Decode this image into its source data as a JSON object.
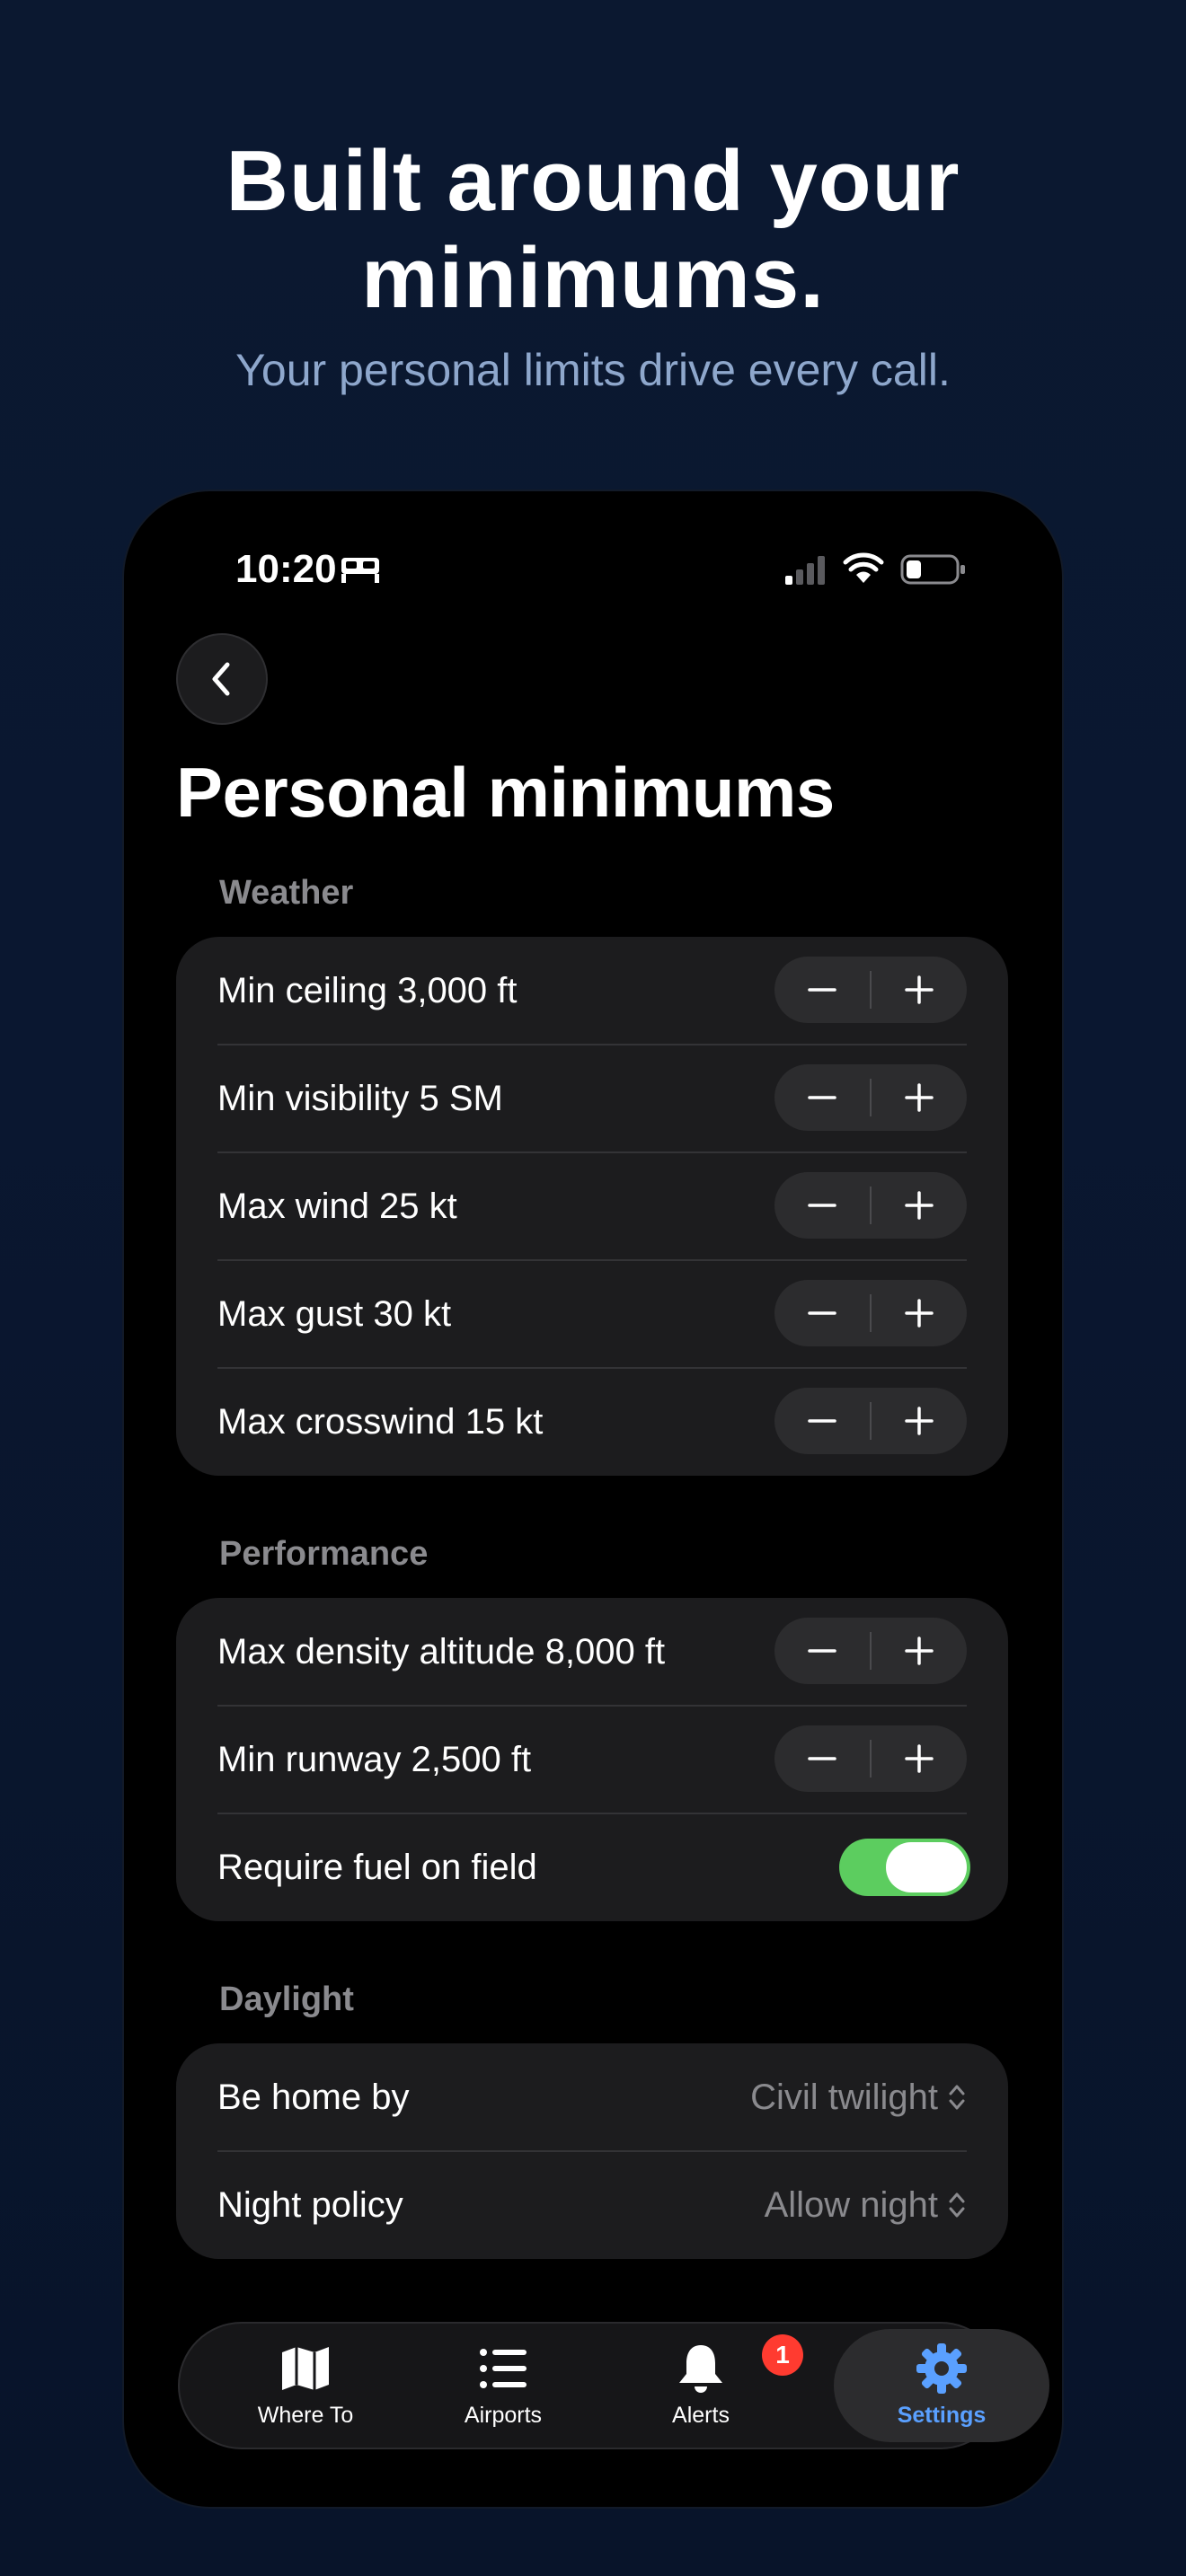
{
  "hero": {
    "title": "Built around your minimums.",
    "subtitle": "Your personal limits drive every call."
  },
  "status_bar": {
    "time": "10:20",
    "icons": [
      "bed-icon",
      "signal-icon",
      "wifi-icon",
      "battery-icon"
    ]
  },
  "nav": {
    "back_icon": "chevron-left-icon"
  },
  "page_title": "Personal minimums",
  "sections": {
    "weather": {
      "header": "Weather",
      "rows": [
        {
          "label": "Min ceiling 3,000 ft",
          "control": "stepper"
        },
        {
          "label": "Min visibility 5 SM",
          "control": "stepper"
        },
        {
          "label": "Max wind 25 kt",
          "control": "stepper"
        },
        {
          "label": "Max gust 30 kt",
          "control": "stepper"
        },
        {
          "label": "Max crosswind 15 kt",
          "control": "stepper"
        }
      ]
    },
    "performance": {
      "header": "Performance",
      "rows": [
        {
          "label": "Max density altitude 8,000 ft",
          "control": "stepper"
        },
        {
          "label": "Min runway 2,500 ft",
          "control": "stepper"
        },
        {
          "label": "Require fuel on field",
          "control": "toggle",
          "value": true
        }
      ]
    },
    "daylight": {
      "header": "Daylight",
      "rows": [
        {
          "label": "Be home by",
          "value": "Civil twilight",
          "control": "picker"
        },
        {
          "label": "Night policy",
          "value": "Allow night",
          "control": "picker"
        }
      ]
    }
  },
  "tab_bar": {
    "tabs": [
      {
        "label": "Where To",
        "icon": "map-icon"
      },
      {
        "label": "Airports",
        "icon": "list-icon"
      },
      {
        "label": "Alerts",
        "icon": "bell-icon",
        "badge": "1"
      },
      {
        "label": "Settings",
        "icon": "gear-icon",
        "active": true
      }
    ]
  },
  "colors": {
    "accent": "#5aa0ff",
    "toggle_on": "#5ccd5f",
    "badge": "#ff3b30",
    "card": "#1c1c1e",
    "background": "#0b1830"
  }
}
